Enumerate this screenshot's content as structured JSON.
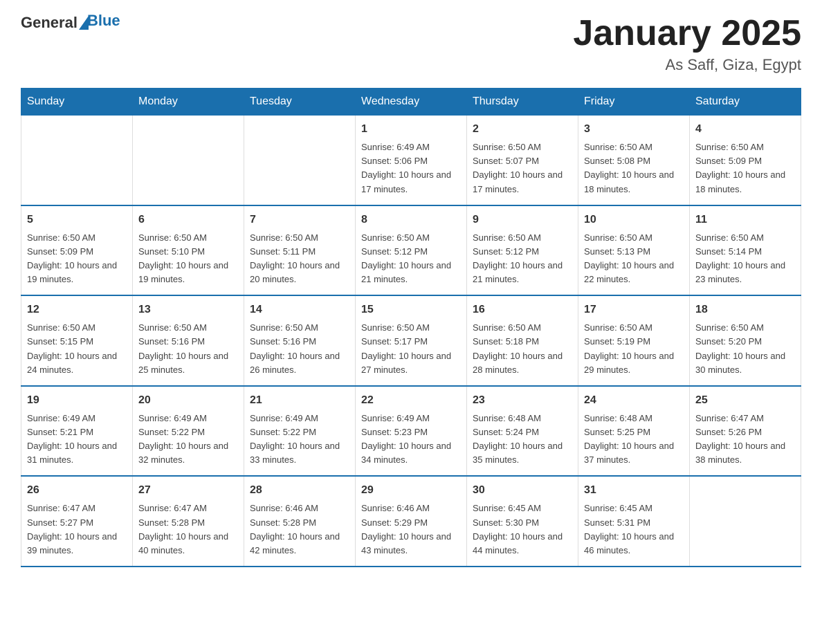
{
  "header": {
    "logo_general": "General",
    "logo_blue": "Blue",
    "title": "January 2025",
    "subtitle": "As Saff, Giza, Egypt"
  },
  "days_of_week": [
    "Sunday",
    "Monday",
    "Tuesday",
    "Wednesday",
    "Thursday",
    "Friday",
    "Saturday"
  ],
  "weeks": [
    [
      {
        "day": "",
        "info": ""
      },
      {
        "day": "",
        "info": ""
      },
      {
        "day": "",
        "info": ""
      },
      {
        "day": "1",
        "info": "Sunrise: 6:49 AM\nSunset: 5:06 PM\nDaylight: 10 hours\nand 17 minutes."
      },
      {
        "day": "2",
        "info": "Sunrise: 6:50 AM\nSunset: 5:07 PM\nDaylight: 10 hours\nand 17 minutes."
      },
      {
        "day": "3",
        "info": "Sunrise: 6:50 AM\nSunset: 5:08 PM\nDaylight: 10 hours\nand 18 minutes."
      },
      {
        "day": "4",
        "info": "Sunrise: 6:50 AM\nSunset: 5:09 PM\nDaylight: 10 hours\nand 18 minutes."
      }
    ],
    [
      {
        "day": "5",
        "info": "Sunrise: 6:50 AM\nSunset: 5:09 PM\nDaylight: 10 hours\nand 19 minutes."
      },
      {
        "day": "6",
        "info": "Sunrise: 6:50 AM\nSunset: 5:10 PM\nDaylight: 10 hours\nand 19 minutes."
      },
      {
        "day": "7",
        "info": "Sunrise: 6:50 AM\nSunset: 5:11 PM\nDaylight: 10 hours\nand 20 minutes."
      },
      {
        "day": "8",
        "info": "Sunrise: 6:50 AM\nSunset: 5:12 PM\nDaylight: 10 hours\nand 21 minutes."
      },
      {
        "day": "9",
        "info": "Sunrise: 6:50 AM\nSunset: 5:12 PM\nDaylight: 10 hours\nand 21 minutes."
      },
      {
        "day": "10",
        "info": "Sunrise: 6:50 AM\nSunset: 5:13 PM\nDaylight: 10 hours\nand 22 minutes."
      },
      {
        "day": "11",
        "info": "Sunrise: 6:50 AM\nSunset: 5:14 PM\nDaylight: 10 hours\nand 23 minutes."
      }
    ],
    [
      {
        "day": "12",
        "info": "Sunrise: 6:50 AM\nSunset: 5:15 PM\nDaylight: 10 hours\nand 24 minutes."
      },
      {
        "day": "13",
        "info": "Sunrise: 6:50 AM\nSunset: 5:16 PM\nDaylight: 10 hours\nand 25 minutes."
      },
      {
        "day": "14",
        "info": "Sunrise: 6:50 AM\nSunset: 5:16 PM\nDaylight: 10 hours\nand 26 minutes."
      },
      {
        "day": "15",
        "info": "Sunrise: 6:50 AM\nSunset: 5:17 PM\nDaylight: 10 hours\nand 27 minutes."
      },
      {
        "day": "16",
        "info": "Sunrise: 6:50 AM\nSunset: 5:18 PM\nDaylight: 10 hours\nand 28 minutes."
      },
      {
        "day": "17",
        "info": "Sunrise: 6:50 AM\nSunset: 5:19 PM\nDaylight: 10 hours\nand 29 minutes."
      },
      {
        "day": "18",
        "info": "Sunrise: 6:50 AM\nSunset: 5:20 PM\nDaylight: 10 hours\nand 30 minutes."
      }
    ],
    [
      {
        "day": "19",
        "info": "Sunrise: 6:49 AM\nSunset: 5:21 PM\nDaylight: 10 hours\nand 31 minutes."
      },
      {
        "day": "20",
        "info": "Sunrise: 6:49 AM\nSunset: 5:22 PM\nDaylight: 10 hours\nand 32 minutes."
      },
      {
        "day": "21",
        "info": "Sunrise: 6:49 AM\nSunset: 5:22 PM\nDaylight: 10 hours\nand 33 minutes."
      },
      {
        "day": "22",
        "info": "Sunrise: 6:49 AM\nSunset: 5:23 PM\nDaylight: 10 hours\nand 34 minutes."
      },
      {
        "day": "23",
        "info": "Sunrise: 6:48 AM\nSunset: 5:24 PM\nDaylight: 10 hours\nand 35 minutes."
      },
      {
        "day": "24",
        "info": "Sunrise: 6:48 AM\nSunset: 5:25 PM\nDaylight: 10 hours\nand 37 minutes."
      },
      {
        "day": "25",
        "info": "Sunrise: 6:47 AM\nSunset: 5:26 PM\nDaylight: 10 hours\nand 38 minutes."
      }
    ],
    [
      {
        "day": "26",
        "info": "Sunrise: 6:47 AM\nSunset: 5:27 PM\nDaylight: 10 hours\nand 39 minutes."
      },
      {
        "day": "27",
        "info": "Sunrise: 6:47 AM\nSunset: 5:28 PM\nDaylight: 10 hours\nand 40 minutes."
      },
      {
        "day": "28",
        "info": "Sunrise: 6:46 AM\nSunset: 5:28 PM\nDaylight: 10 hours\nand 42 minutes."
      },
      {
        "day": "29",
        "info": "Sunrise: 6:46 AM\nSunset: 5:29 PM\nDaylight: 10 hours\nand 43 minutes."
      },
      {
        "day": "30",
        "info": "Sunrise: 6:45 AM\nSunset: 5:30 PM\nDaylight: 10 hours\nand 44 minutes."
      },
      {
        "day": "31",
        "info": "Sunrise: 6:45 AM\nSunset: 5:31 PM\nDaylight: 10 hours\nand 46 minutes."
      },
      {
        "day": "",
        "info": ""
      }
    ]
  ]
}
